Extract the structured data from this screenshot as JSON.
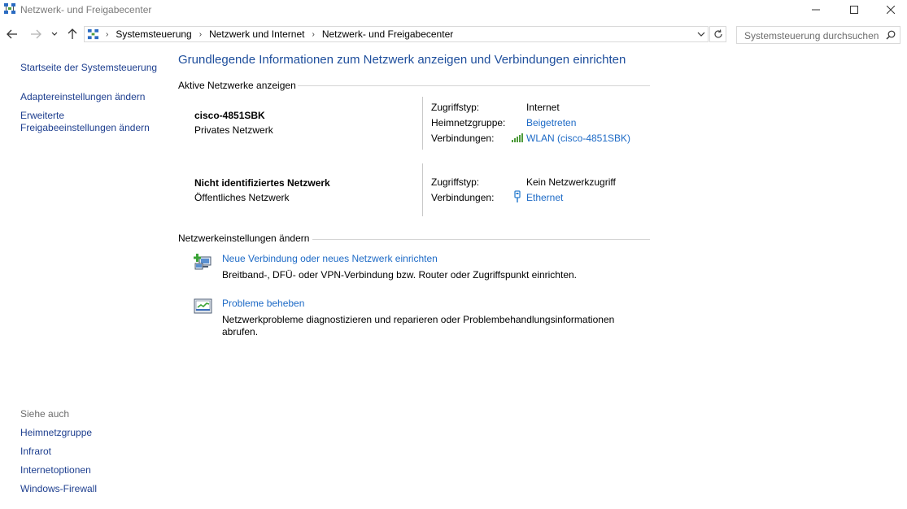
{
  "window": {
    "title": "Netzwerk- und Freigabecenter"
  },
  "address": {
    "crumbs": [
      "Systemsteuerung",
      "Netzwerk und Internet",
      "Netzwerk- und Freigabecenter"
    ]
  },
  "search": {
    "placeholder": "Systemsteuerung durchsuchen"
  },
  "sidebar": {
    "home": "Startseite der Systemsteuerung",
    "adapter": "Adaptereinstellungen ändern",
    "advanced_line1": "Erweiterte",
    "advanced_line2": "Freigabeeinstellungen ändern",
    "see_also_title": "Siehe auch",
    "see_also": [
      "Heimnetzgruppe",
      "Infrarot",
      "Internetoptionen",
      "Windows-Firewall"
    ]
  },
  "main": {
    "heading": "Grundlegende Informationen zum Netzwerk anzeigen und Verbindungen einrichten",
    "active_networks_label": "Aktive Netzwerke anzeigen",
    "networks": [
      {
        "name": "cisco-4851SBK",
        "type": "Privates Netzwerk",
        "access_label": "Zugriffstyp:",
        "access_value": "Internet",
        "homegroup_label": "Heimnetzgruppe:",
        "homegroup_value": "Beigetreten",
        "connections_label": "Verbindungen:",
        "connections_value": "WLAN (cisco-4851SBK)"
      },
      {
        "name": "Nicht identifiziertes Netzwerk",
        "type": "Öffentliches Netzwerk",
        "access_label": "Zugriffstyp:",
        "access_value": "Kein Netzwerkzugriff",
        "connections_label": "Verbindungen:",
        "connections_value": "Ethernet"
      }
    ],
    "change_settings_label": "Netzwerkeinstellungen ändern",
    "tasks": [
      {
        "title": "Neue Verbindung oder neues Netzwerk einrichten",
        "description": "Breitband-, DFÜ- oder VPN-Verbindung bzw. Router oder Zugriffspunkt einrichten."
      },
      {
        "title": "Probleme beheben",
        "description": "Netzwerkprobleme diagnostizieren und reparieren oder Problembehandlungsinformationen abrufen."
      }
    ]
  },
  "colors": {
    "heading": "#1e4e9c",
    "link": "#1d6ac6",
    "nav_link": "#1e3f8f"
  },
  "icons": {
    "app": "network-sharing-center-icon",
    "wifi": "wifi-signal-icon",
    "ethernet": "ethernet-icon",
    "new_connection": "new-connection-icon",
    "troubleshoot": "troubleshoot-icon"
  }
}
